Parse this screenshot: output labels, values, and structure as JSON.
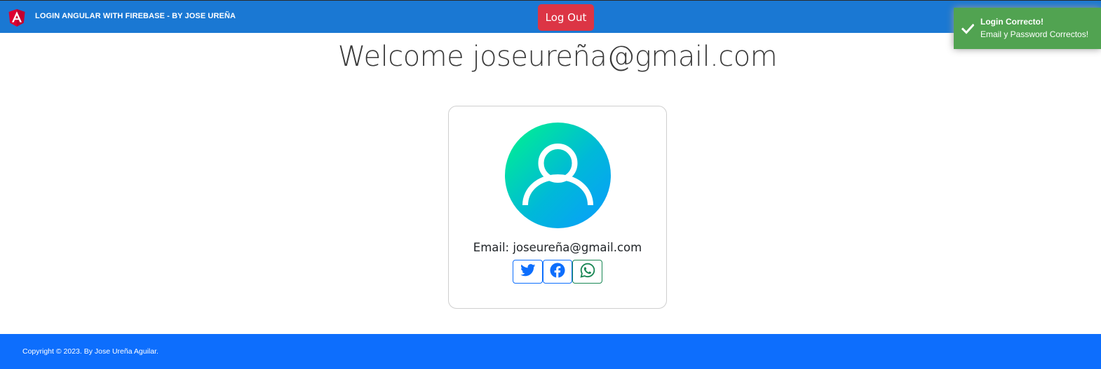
{
  "navbar": {
    "brand_logo_icon": "angular-logo-icon",
    "title": "LOGIN ANGULAR WITH FIREBASE - BY JOSE UREÑA",
    "logout_label": "Log Out",
    "background_color": "#1a78d3",
    "logout_color": "#dc3545"
  },
  "toast": {
    "icon": "checkmark-icon",
    "title": "Login Correcto!",
    "message": "Email y Password Correctos!",
    "background_color": "#51a351"
  },
  "main": {
    "welcome_text": "Welcome joseureña@gmail.com"
  },
  "profile_card": {
    "avatar_icon": "user-avatar-icon",
    "email_text": "Email: joseureña@gmail.com",
    "social_buttons": [
      {
        "icon": "twitter-icon",
        "color": "#0d6efd"
      },
      {
        "icon": "facebook-icon",
        "color": "#0d6efd"
      },
      {
        "icon": "whatsapp-icon",
        "color": "#198754"
      }
    ]
  },
  "footer": {
    "copyright": "Copyright © 2023. By Jose Ureña Aguilar.",
    "background_color": "#0d6efd"
  }
}
